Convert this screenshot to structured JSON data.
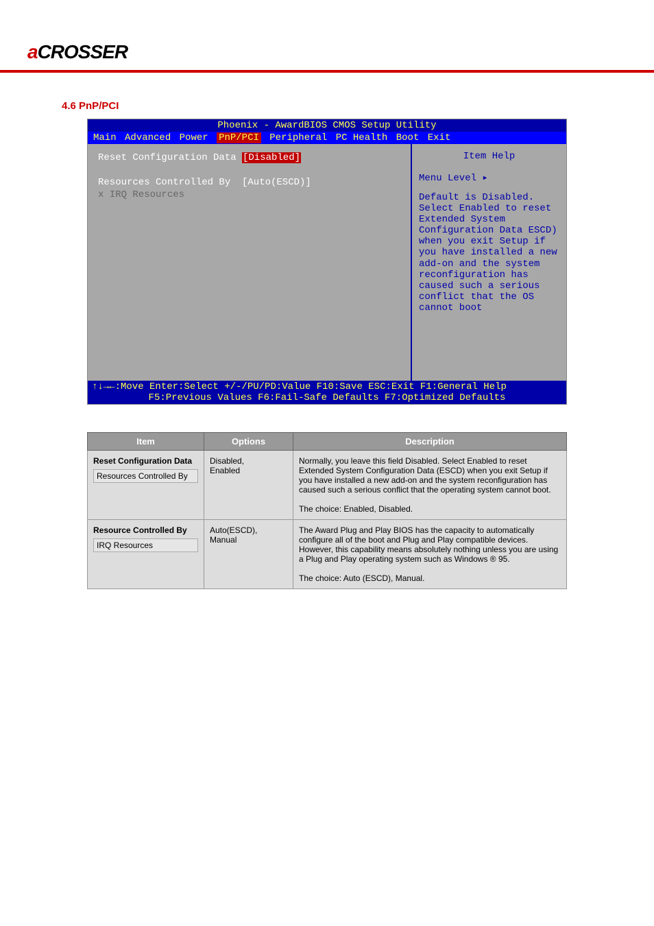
{
  "logo": {
    "a": "a",
    "rest": "CROSSER"
  },
  "section_title": "4.6 PnP/PCI",
  "bios": {
    "title": "Phoenix - AwardBIOS CMOS Setup Utility",
    "menu": [
      "Main",
      "Advanced",
      "Power",
      "PnP/PCI",
      "Peripheral",
      "PC Health",
      "Boot",
      "Exit"
    ],
    "active_menu_index": 3,
    "rows": [
      {
        "label": "Reset Configuration Data",
        "value": "[Disabled]",
        "highlight": true,
        "sub": false
      },
      {
        "label": "",
        "value": "",
        "sub": false
      },
      {
        "label": "Resources Controlled By",
        "value": "[Auto(ESCD)]",
        "highlight": false,
        "sub": false
      },
      {
        "label": "x IRQ Resources",
        "value": "",
        "highlight": false,
        "sub": true
      }
    ],
    "help_title": "Item Help",
    "menu_level": "Menu Level   ▸",
    "help_text": "Default is Disabled. Select Enabled to reset Extended System Configuration Data ESCD) when you exit Setup if you have installed a new add-on and the system reconfiguration has caused such a serious conflict that the OS cannot boot",
    "footer1": "↑↓→←:Move  Enter:Select  +/-/PU/PD:Value  F10:Save  ESC:Exit  F1:General Help",
    "footer2": "F5:Previous Values    F6:Fail-Safe Defaults    F7:Optimized Defaults"
  },
  "table": {
    "headers": [
      "Item",
      "Options",
      "Description"
    ],
    "rows": [
      {
        "item_title": "Reset Configuration Data",
        "item_box": "Resources Controlled By",
        "options": "Disabled,\nEnabled",
        "desc": "Normally, you leave this field Disabled. Select Enabled to reset Extended System Configuration Data (ESCD) when you exit Setup if you have installed a new add-on and the system reconfiguration has caused such a serious conflict that the operating system cannot boot.\n\nThe choice: Enabled, Disabled."
      },
      {
        "item_title": "Resource Controlled By",
        "item_box": "IRQ Resources",
        "options": "Auto(ESCD),\nManual",
        "desc": "The Award Plug and Play BIOS has the capacity to automatically configure all of the boot and Plug and Play compatible devices. However, this capability means absolutely nothing unless you are using a Plug and Play operating system such as Windows ® 95.\n\nThe choice: Auto (ESCD), Manual."
      }
    ]
  }
}
